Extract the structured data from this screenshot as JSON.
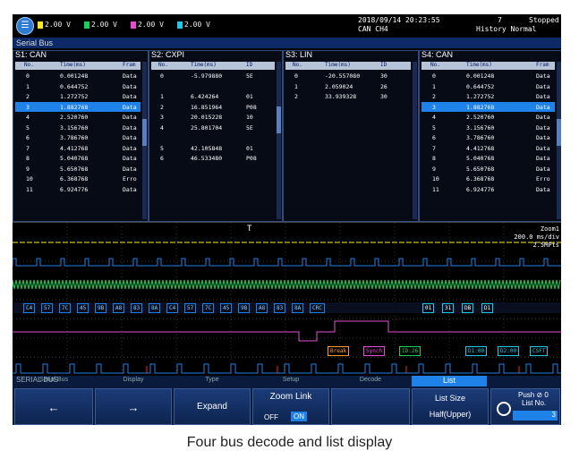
{
  "topbar": {
    "channels": [
      {
        "ch": "CH1",
        "scale": "2.00 V",
        "color": "#f5e92a"
      },
      {
        "ch": "CH2",
        "scale": "2.00 V",
        "color": "#19d15a"
      },
      {
        "ch": "CH3",
        "scale": "2.00 V",
        "color": "#e94bd5"
      },
      {
        "ch": "CH4",
        "scale": "2.00 V",
        "color": "#1fc7e8"
      }
    ],
    "datetime": "2018/09/14 20:23:55",
    "source": "CAN CH4",
    "history_count": "7",
    "history_mode": "History Normal",
    "status": "Stopped"
  },
  "title": "Serial Bus",
  "panels": [
    {
      "title": "S1: CAN",
      "headers": [
        "No.",
        "Time(ms)",
        "Fram"
      ],
      "rows": [
        [
          "0",
          "0.001248",
          "Data"
        ],
        [
          "1",
          "0.644752",
          "Data"
        ],
        [
          "2",
          "1.272752",
          "Data"
        ],
        [
          "3",
          "1.882768",
          "Data"
        ],
        [
          "4",
          "2.520760",
          "Data"
        ],
        [
          "5",
          "3.156760",
          "Data"
        ],
        [
          "6",
          "3.786760",
          "Data"
        ],
        [
          "7",
          "4.412768",
          "Data"
        ],
        [
          "8",
          "5.040768",
          "Data"
        ],
        [
          "9",
          "5.650768",
          "Data"
        ],
        [
          "10",
          "6.368768",
          "Erro"
        ],
        [
          "11",
          "6.924776",
          "Data"
        ]
      ],
      "selected": 3
    },
    {
      "title": "S2: CXPI",
      "headers": [
        "No.",
        "Time(ms)",
        "ID"
      ],
      "rows": [
        [
          "0",
          "-5.979880",
          "5E"
        ],
        [
          "",
          "",
          " "
        ],
        [
          "1",
          "6.424264",
          "01"
        ],
        [
          "2",
          "16.851964",
          "P08"
        ],
        [
          "3",
          "20.015228",
          "10"
        ],
        [
          "4",
          "25.801704",
          "5E"
        ],
        [
          "",
          "",
          " "
        ],
        [
          "5",
          "42.105848",
          "01"
        ],
        [
          "6",
          "46.533480",
          "P08"
        ]
      ],
      "selected": -1
    },
    {
      "title": "S3: LIN",
      "headers": [
        "No.",
        "Time(ms)",
        "ID"
      ],
      "rows": [
        [
          "0",
          "-20.557080",
          "30"
        ],
        [
          "1",
          "2.059024",
          "26"
        ],
        [
          "2",
          "33.939328",
          "30"
        ]
      ],
      "selected": -1
    },
    {
      "title": "S4: CAN",
      "headers": [
        "No.",
        "Time(ms)",
        "Fram"
      ],
      "rows": [
        [
          "0",
          "0.001248",
          "Data"
        ],
        [
          "1",
          "0.644752",
          "Data"
        ],
        [
          "2",
          "1.272752",
          "Data"
        ],
        [
          "3",
          "1.882768",
          "Data"
        ],
        [
          "4",
          "2.520760",
          "Data"
        ],
        [
          "5",
          "3.156760",
          "Data"
        ],
        [
          "6",
          "3.786760",
          "Data"
        ],
        [
          "7",
          "4.412768",
          "Data"
        ],
        [
          "8",
          "5.040768",
          "Data"
        ],
        [
          "9",
          "5.650768",
          "Data"
        ],
        [
          "10",
          "6.368768",
          "Erro"
        ],
        [
          "11",
          "6.924776",
          "Data"
        ]
      ],
      "selected": 3
    }
  ],
  "wave": {
    "zoom_label": "Zoom1",
    "zoom_scale": "200.0 ms/div",
    "zoom_points": "2.5MPts",
    "trigger_marker": "T",
    "s1_bytes": [
      "C4",
      "57",
      "7C",
      "45",
      "9B",
      "A8",
      "83",
      "8A",
      "C4",
      "57",
      "7C",
      "45",
      "9B",
      "A8",
      "83",
      "8A",
      "CRC"
    ],
    "s4_bytes": [
      "01",
      "31",
      "DB",
      "D1"
    ],
    "lin_labels": [
      "Break",
      "Synch",
      "ID:26"
    ],
    "cxpi_labels": [
      "D1:00",
      "D2:00",
      "CSFT"
    ]
  },
  "softkeys": {
    "section_label": "SERIAL BUS",
    "keys": [
      {
        "title": "Serial Bus",
        "label": "←"
      },
      {
        "title": "Display",
        "label": "→"
      },
      {
        "title": "Type",
        "label": "Expand"
      },
      {
        "title": "Setup",
        "label": "Zoom Link",
        "off": "OFF",
        "on": "ON"
      },
      {
        "title": "Decode",
        "label": ""
      }
    ],
    "list": {
      "header": "List",
      "size_label": "List Size",
      "size_value": "Half(Upper)"
    },
    "push": {
      "label": "Push",
      "value": "0",
      "list_no_label": "List No.",
      "list_no": "3"
    }
  },
  "caption": "Four bus decode and list display"
}
